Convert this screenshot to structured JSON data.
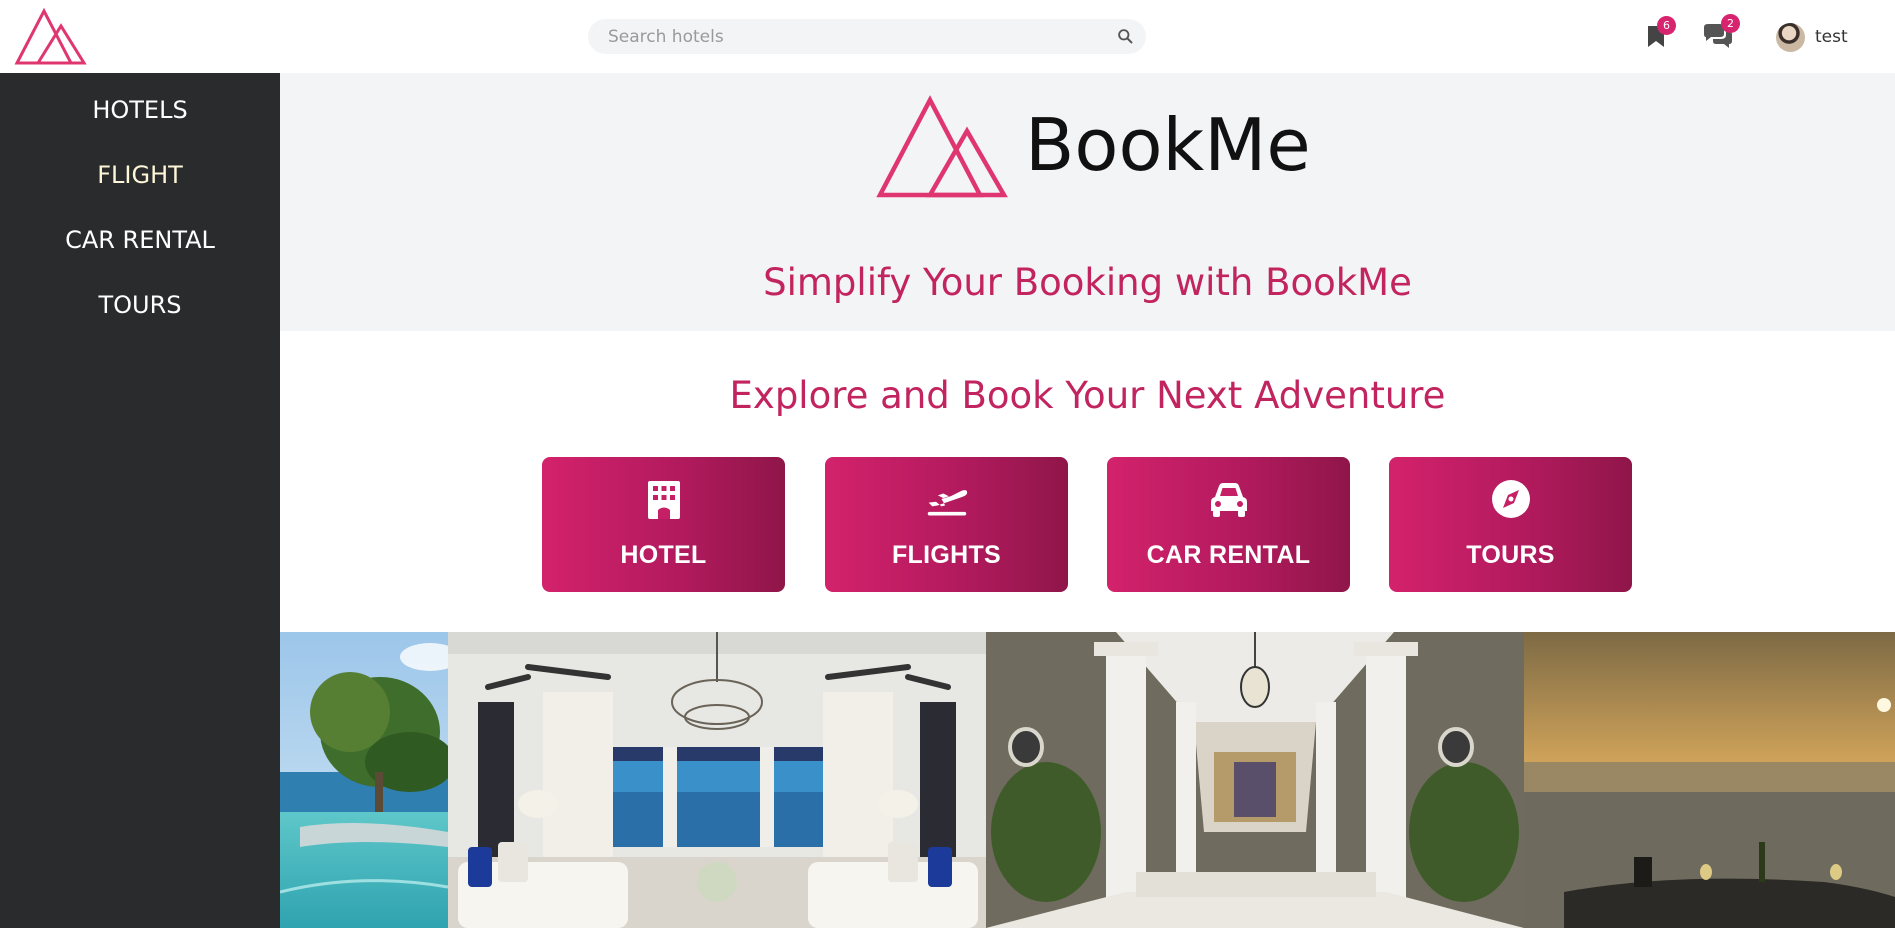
{
  "header": {
    "search": {
      "placeholder": "Search hotels"
    },
    "bookmarks_badge": "6",
    "messages_badge": "2",
    "user_name": "test"
  },
  "sidebar": {
    "items": [
      {
        "label": "HOTELS"
      },
      {
        "label": "FLIGHT"
      },
      {
        "label": "CAR RENTAL"
      },
      {
        "label": "TOURS"
      }
    ]
  },
  "hero": {
    "brand": "BookMe",
    "tagline": "Simplify Your Booking with BookMe"
  },
  "explore": {
    "title": "Explore and Book Your Next Adventure",
    "categories": [
      {
        "label": "HOTEL",
        "icon": "hotel-icon"
      },
      {
        "label": "FLIGHTS",
        "icon": "plane-icon"
      },
      {
        "label": "CAR RENTAL",
        "icon": "car-icon"
      },
      {
        "label": "TOURS",
        "icon": "compass-icon"
      }
    ]
  },
  "colors": {
    "accent": "#d6246e",
    "sidebar_bg": "#2a2b2d",
    "hero_bg": "#f3f4f6",
    "heading": "#c2245f"
  }
}
